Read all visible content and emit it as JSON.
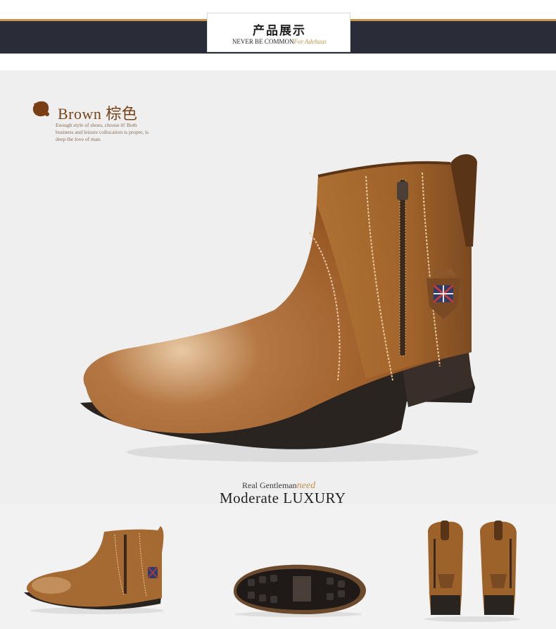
{
  "header": {
    "title": "产品展示",
    "subtitle": "NEVER BE COMMON",
    "subtitle_script": "For Adehaus"
  },
  "color_section": {
    "label": "Brown 棕色",
    "description": "Enough style of shoes, choose it! Both business and leisure collocation is proper, is deep the love of man.",
    "swatch_color": "#7a3e14"
  },
  "slogan": {
    "line1": "Real Gentleman",
    "line1_script": "need",
    "line2": "Moderate LUXURY"
  },
  "colors": {
    "band": "#2a2d38",
    "accent": "#c7954d",
    "leather": "#a4642c",
    "sole": "#2a2420"
  },
  "images": {
    "main": "brown-zip-boot-main-view",
    "thumb_1": "brown-zip-boot-side-view",
    "thumb_2": "boot-sole-view",
    "thumb_3": "brown-boots-back-view"
  }
}
